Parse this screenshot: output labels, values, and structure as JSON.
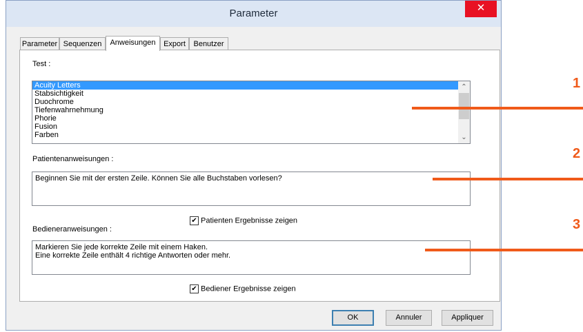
{
  "window": {
    "title": "Parameter",
    "close_glyph": "✕"
  },
  "tabs": [
    {
      "label": "Parameter"
    },
    {
      "label": "Sequenzen"
    },
    {
      "label": "Anweisungen"
    },
    {
      "label": "Export"
    },
    {
      "label": "Benutzer"
    }
  ],
  "active_tab": "Anweisungen",
  "test": {
    "label": "Test :",
    "items": [
      "Acuity Letters",
      "Stabsichtigkeit",
      "Duochrome",
      "Tiefenwahrnehmung",
      "Phorie",
      "Fusion",
      "Farben"
    ],
    "selected": "Acuity Letters"
  },
  "patient": {
    "label": "Patientenanweisungen :",
    "text": "Beginnen Sie mit der ersten Zeile. Können Sie alle Buchstaben vorlesen?",
    "checkbox_label": "Patienten Ergebnisse zeigen",
    "checked": true
  },
  "operator": {
    "label": "Bedieneranweisungen :",
    "line1": "Markieren Sie jede korrekte Zeile mit einem Haken.",
    "line2": "Eine korrekte Zeile enthält 4 richtige Antworten oder mehr.",
    "checkbox_label": "Bediener Ergebnisse zeigen",
    "checked": true
  },
  "buttons": {
    "ok": "OK",
    "cancel": "Annuler",
    "apply": "Appliquer"
  },
  "callouts": [
    "1",
    "2",
    "3"
  ],
  "colors": {
    "callout": "#f05a1a",
    "selection": "#3399ff",
    "close": "#e81123"
  }
}
